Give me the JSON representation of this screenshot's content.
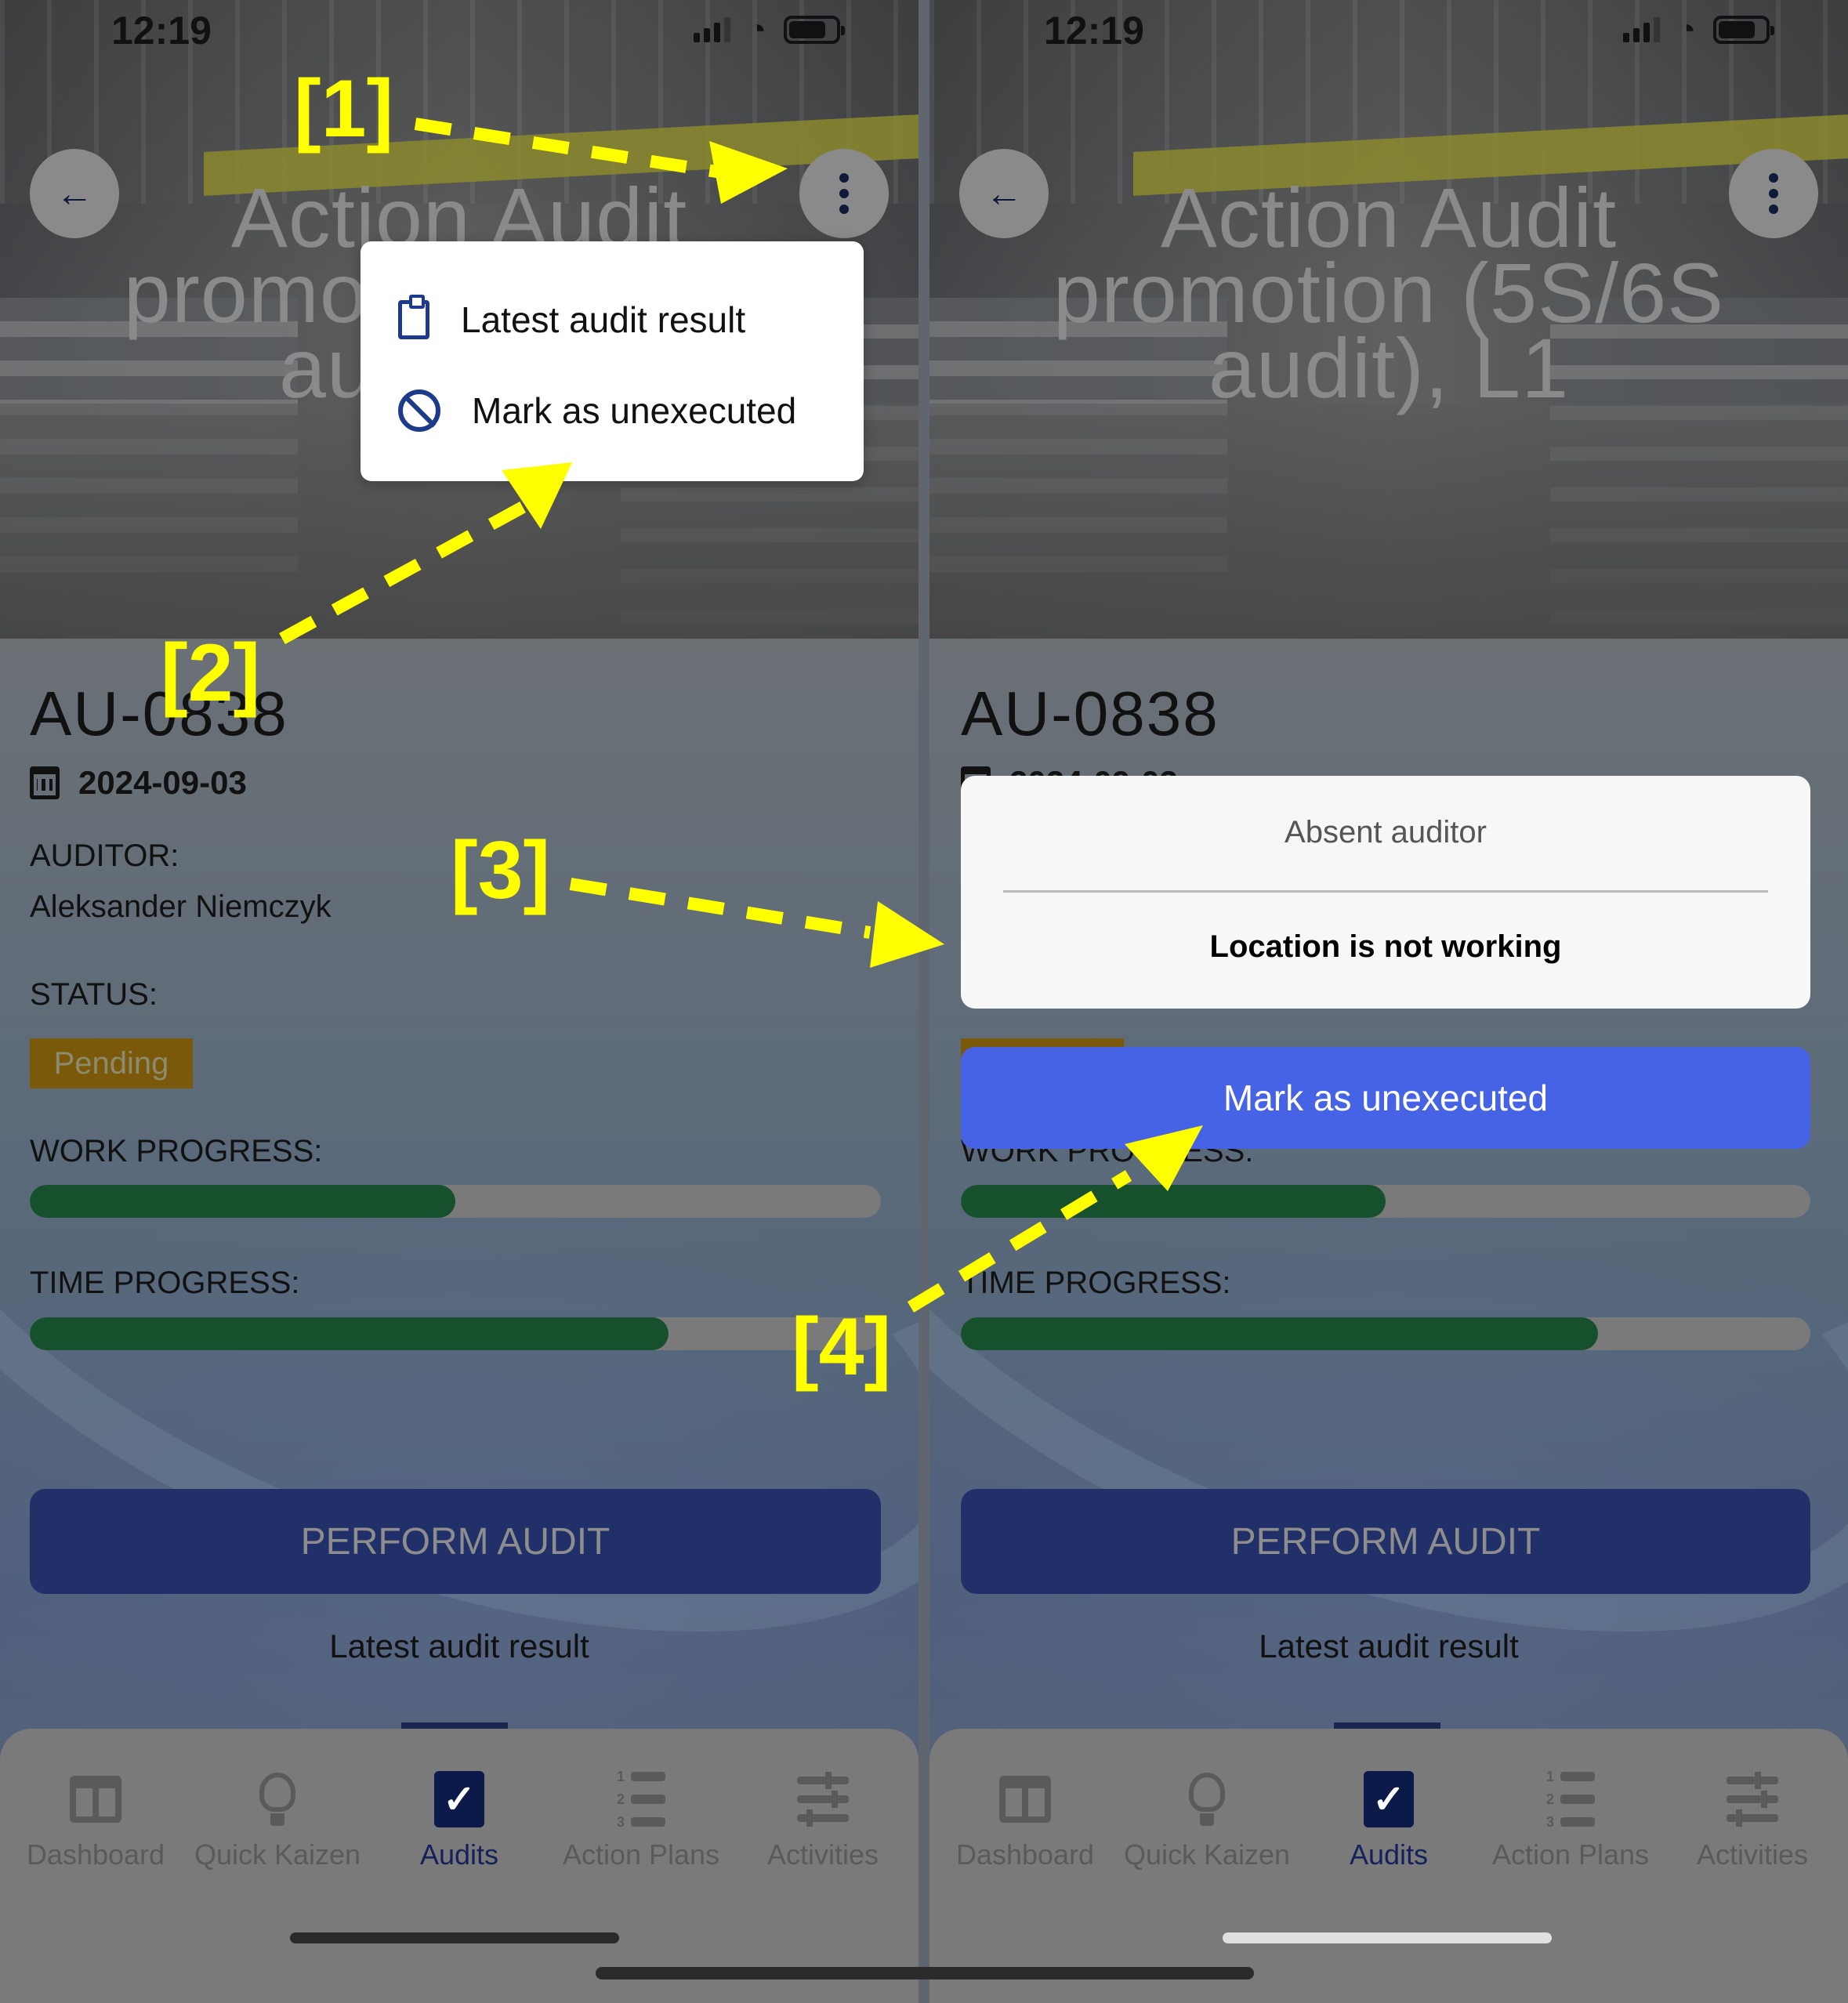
{
  "status_bar": {
    "time": "12:19"
  },
  "header": {
    "title": "Action Audit promotion (5S/6S audit), L1",
    "back_icon": "arrow-left-icon",
    "more_icon": "more-vertical-icon"
  },
  "audit": {
    "id": "AU-0838",
    "date": "2024-09-03",
    "auditor_label": "AUDITOR:",
    "auditor_name": "Aleksander Niemczyk",
    "status_label": "STATUS:",
    "status_value": "Pending",
    "status_color": "#7a5a0a",
    "work_progress_label": "WORK PROGRESS:",
    "work_progress_percent": 50,
    "time_progress_label": "TIME PROGRESS:",
    "time_progress_percent": 75,
    "progress_color": "#16502c"
  },
  "buttons": {
    "perform_audit": "PERFORM AUDIT",
    "latest_result_link": "Latest audit result"
  },
  "popup_menu": {
    "items": [
      {
        "label": "Latest audit result",
        "icon": "clipboard-icon"
      },
      {
        "label": "Mark as unexecuted",
        "icon": "ban-icon"
      }
    ]
  },
  "action_sheet": {
    "options": [
      "Absent auditor",
      "Location is not working"
    ],
    "confirm_label": "Mark as unexecuted",
    "confirm_color": "#4563e4"
  },
  "tabbar": {
    "items": [
      {
        "label": "Dashboard",
        "icon": "dashboard-icon",
        "active": false
      },
      {
        "label": "Quick Kaizen",
        "icon": "lightbulb-icon",
        "active": false
      },
      {
        "label": "Audits",
        "icon": "checkbox-icon",
        "active": true
      },
      {
        "label": "Action Plans",
        "icon": "numbered-list-icon",
        "active": false
      },
      {
        "label": "Activities",
        "icon": "sliders-icon",
        "active": false
      }
    ]
  },
  "annotations": [
    "[1]",
    "[2]",
    "[3]",
    "[4]"
  ]
}
